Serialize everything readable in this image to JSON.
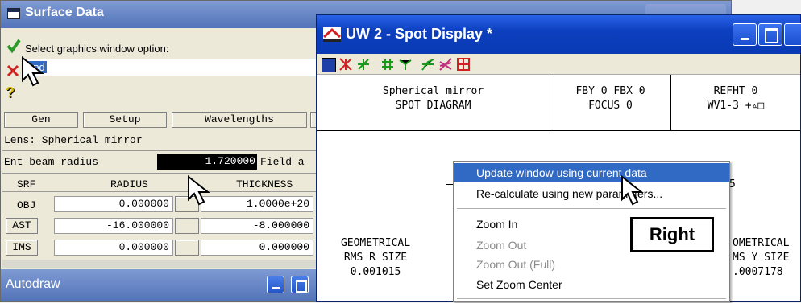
{
  "surface_window": {
    "title": "Surface Data",
    "prompt": "Select graphics window option:",
    "input_value": "upd",
    "buttons": [
      "Gen",
      "Setup",
      "Wavelengths"
    ],
    "lens_label": "Lens: Spherical mirror",
    "ent_beam_label": "Ent beam radius",
    "ent_beam_value": "1.720000",
    "field_label": "Field a",
    "columns": [
      "SRF",
      "RADIUS",
      "THICKNESS"
    ],
    "rows": [
      {
        "srf": "OBJ",
        "radius": "0.000000",
        "thickness": "1.0000e+20"
      },
      {
        "srf": "AST",
        "radius": "-16.000000",
        "thickness": "-8.000000"
      },
      {
        "srf": "IMS",
        "radius": "0.000000",
        "thickness": "0.000000"
      }
    ]
  },
  "autodraw_window": {
    "title": "Autodraw"
  },
  "spot_window": {
    "title": "UW 2 - Spot Display *",
    "header": {
      "c1_l1": "Spherical mirror",
      "c1_l2": "SPOT DIAGRAM",
      "c2_l1": "FBY 0 FBX 0",
      "c2_l2": "FOCUS 0",
      "c3_l1": "REFHT 0",
      "c3_l2": "WV1-3 +▵□"
    },
    "left_label": [
      "GEOMETRICAL",
      "RMS R SIZE",
      "0.001015"
    ],
    "right_label": [
      "OMETRICAL",
      "MS Y SIZE",
      ".0007178"
    ],
    "partial_num": "5"
  },
  "context_menu": {
    "items": [
      {
        "label": "Update window using current data",
        "enabled": true,
        "highlight": true
      },
      {
        "label": "Re-calculate using new parameters...",
        "enabled": true
      },
      {
        "label": "Zoom In",
        "enabled": true
      },
      {
        "label": "Zoom Out",
        "enabled": false
      },
      {
        "label": "Zoom Out (Full)",
        "enabled": false
      },
      {
        "label": "Set Zoom Center",
        "enabled": true
      }
    ]
  },
  "callout": {
    "label": "Right"
  },
  "colors": {
    "highlight": "#316ac5",
    "titlebar": "#0a3ab4",
    "disabled": "#8c8c8c"
  }
}
